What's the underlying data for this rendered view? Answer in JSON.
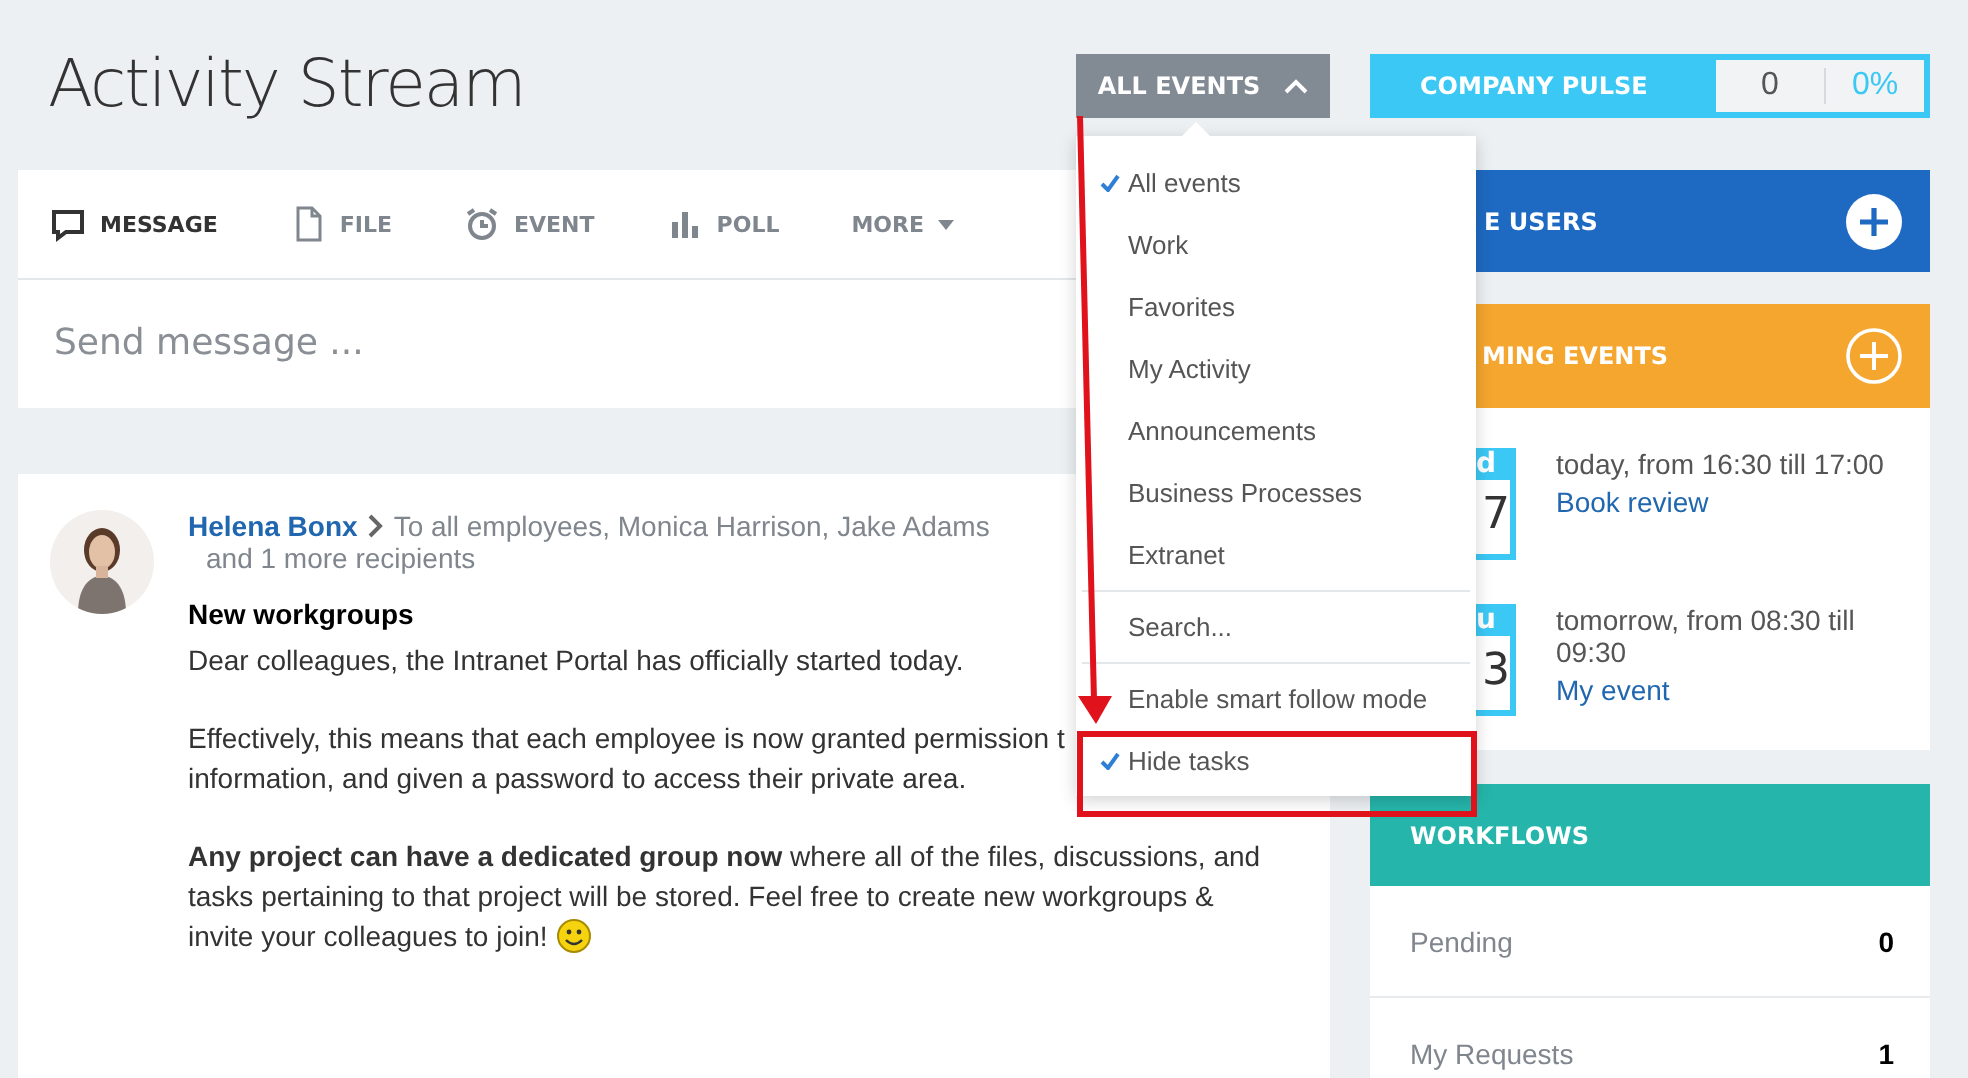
{
  "header": {
    "title": "Activity Stream",
    "filter_button": {
      "label": "ALL EVENTS",
      "expanded": true
    },
    "pulse": {
      "label": "COMPANY PULSE",
      "count": "0",
      "percent": "0%"
    }
  },
  "composer": {
    "tabs": [
      {
        "label": "MESSAGE",
        "kind": "message",
        "selected": true
      },
      {
        "label": "FILE",
        "kind": "file",
        "selected": false
      },
      {
        "label": "EVENT",
        "kind": "event",
        "selected": false
      },
      {
        "label": "POLL",
        "kind": "poll",
        "selected": false
      },
      {
        "label": "MORE",
        "kind": "more",
        "selected": false
      }
    ],
    "placeholder": "Send message ..."
  },
  "post": {
    "author": "Helena Bonx",
    "recipients": "To all employees, Monica Harrison, Jake Adams",
    "more_recipients": "and 1 more recipients",
    "title": "New workgroups",
    "paragraphs": [
      [
        "Dear colleagues, the Intranet Portal has officially started today."
      ],
      [
        "Effectively, this means that each employee is now granted permission t",
        "information, and given a password to access their private area."
      ],
      [
        "**Any project can have a dedicated group now** where all of the files, discussions, and",
        "tasks pertaining to that project will be stored. Feel free to create new workgroups &",
        "invite your colleagues to join!"
      ]
    ]
  },
  "filter_menu": {
    "sections": [
      [
        {
          "label": "All events",
          "checked": true
        },
        {
          "label": "Work",
          "checked": false
        },
        {
          "label": "Favorites",
          "checked": false
        },
        {
          "label": "My Activity",
          "checked": false
        },
        {
          "label": "Announcements",
          "checked": false
        },
        {
          "label": "Business Processes",
          "checked": false
        },
        {
          "label": "Extranet",
          "checked": false
        }
      ],
      [
        {
          "label": "Search...",
          "checked": false
        }
      ],
      [
        {
          "label": "Enable smart follow mode",
          "checked": false
        },
        {
          "label": "Hide tasks",
          "checked": true
        }
      ]
    ]
  },
  "sidebar": {
    "live_users": {
      "title": "E USERS"
    },
    "events": {
      "title": "MING EVENTS",
      "items": [
        {
          "day_label": "d",
          "day_number": "7",
          "time": "today, from 16:30 till 17:00",
          "title": "Book review"
        },
        {
          "day_label": "u",
          "day_number": "3",
          "time": "tomorrow, from 08:30 till 09:30",
          "title": "My event"
        }
      ]
    },
    "workflows": {
      "title": "WORKFLOWS",
      "rows": [
        {
          "label": "Pending",
          "count": "0"
        },
        {
          "label": "My Requests",
          "count": "1"
        }
      ]
    }
  }
}
